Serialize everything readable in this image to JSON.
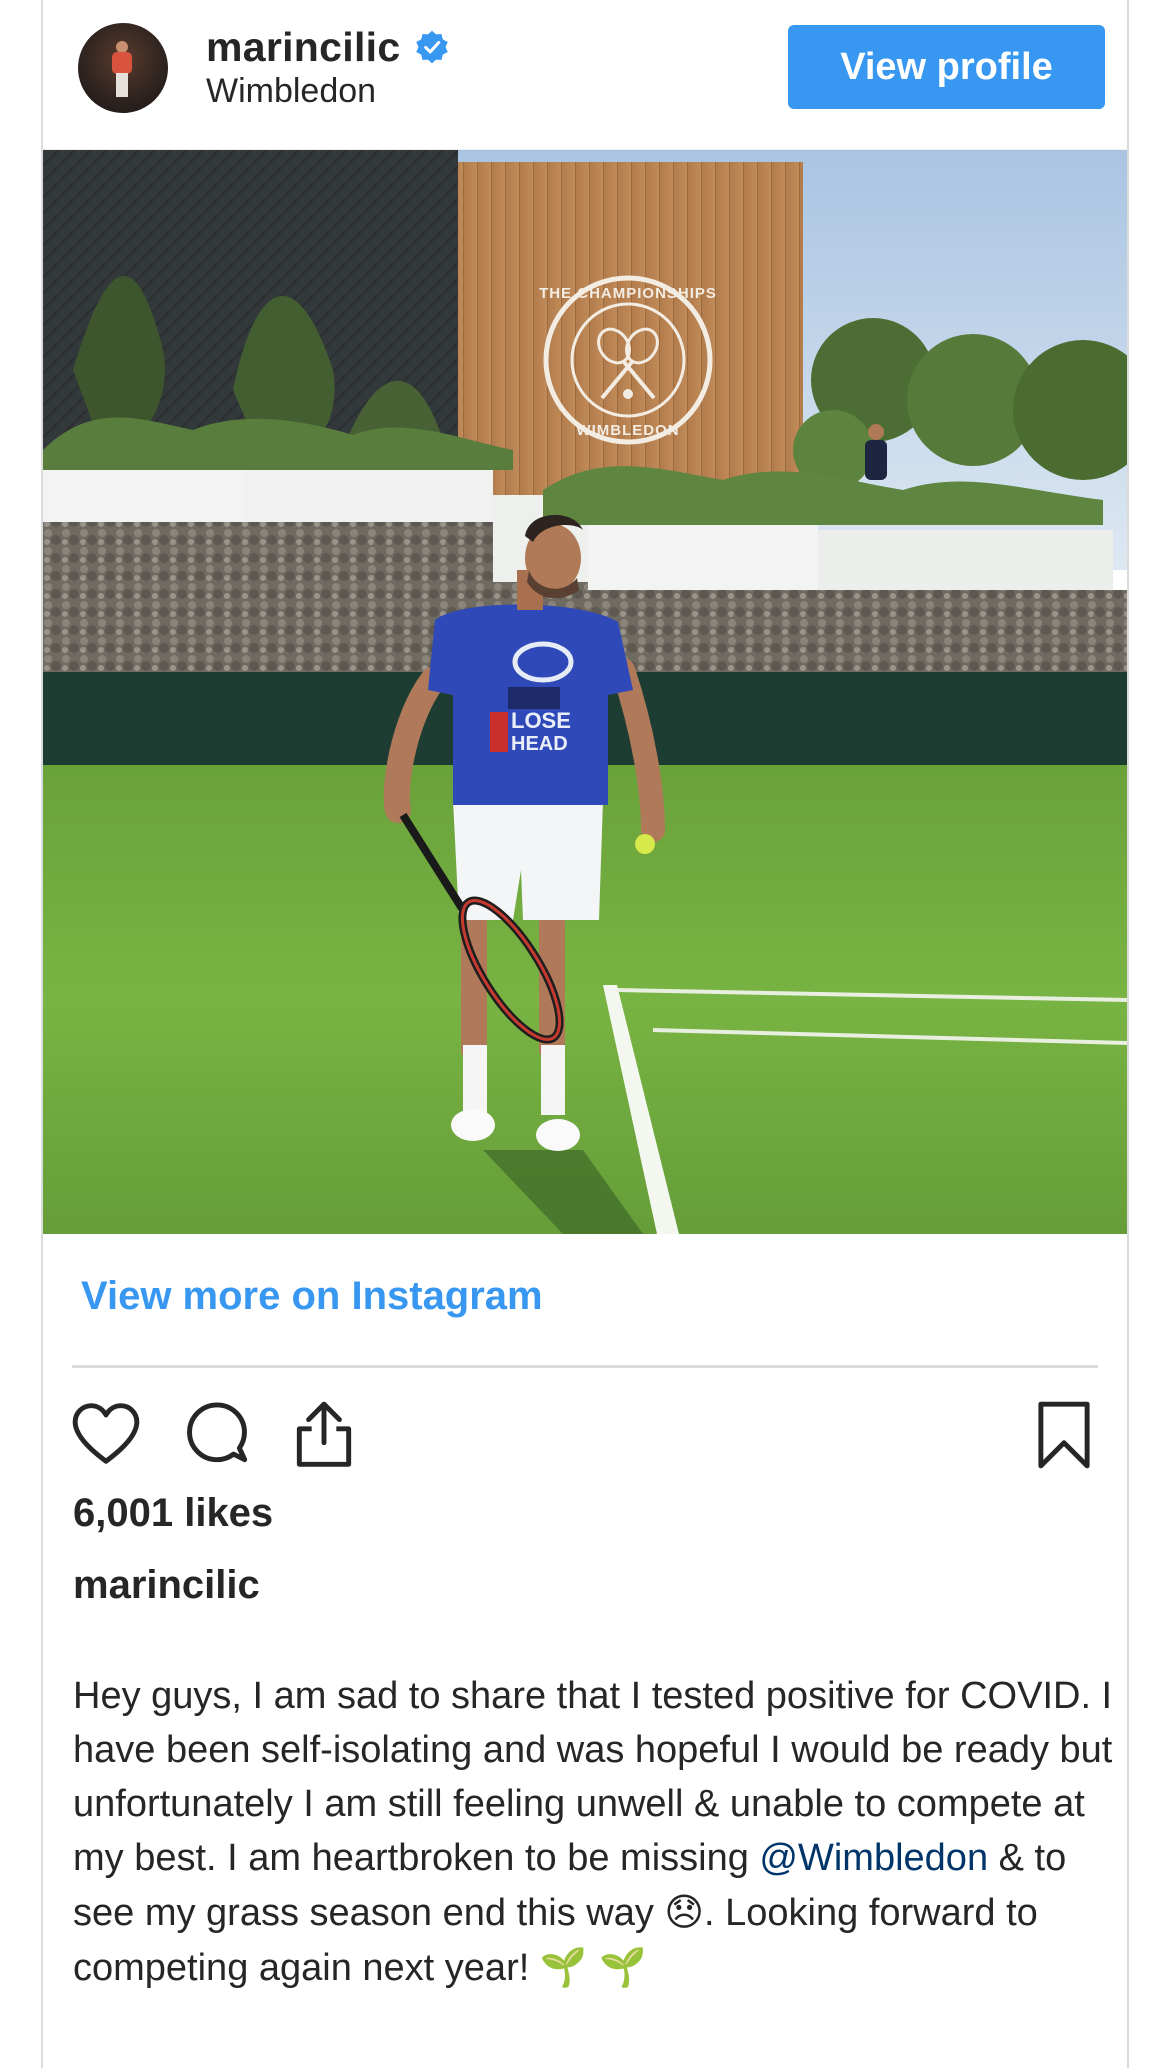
{
  "header": {
    "username": "marincilic",
    "location": "Wimbledon",
    "view_profile_label": "View profile"
  },
  "photo": {
    "sign_top_text": "THE CHAMPIONSHIPS",
    "sign_bottom_text": "WIMBLEDON",
    "shirt_text_line1": "LOSE",
    "shirt_text_line2": "HEAD"
  },
  "view_more_label": "View more on Instagram",
  "actions": {
    "icons": [
      "heart-icon",
      "comment-icon",
      "share-icon",
      "bookmark-icon"
    ]
  },
  "likes_label": "6,001 likes",
  "caption": {
    "username": "marincilic",
    "text_before_mention": "Hey guys, I am sad to share that I tested positive for COVID. I have been self-isolating and was hopeful I would be ready but unfortunately I am still feeling unwell & unable to compete at my best. I am heartbroken to be missing ",
    "mention": "@Wimbledon",
    "text_after_mention": " & to see my grass season end this way ",
    "emoji_sad": "😞",
    "text_end": ". Looking forward to competing again next year! ",
    "emoji_end": "🌱 🌱"
  },
  "colors": {
    "accent": "#3897f0",
    "mention": "#003569",
    "text": "#262626",
    "border": "#dbdbdb"
  }
}
